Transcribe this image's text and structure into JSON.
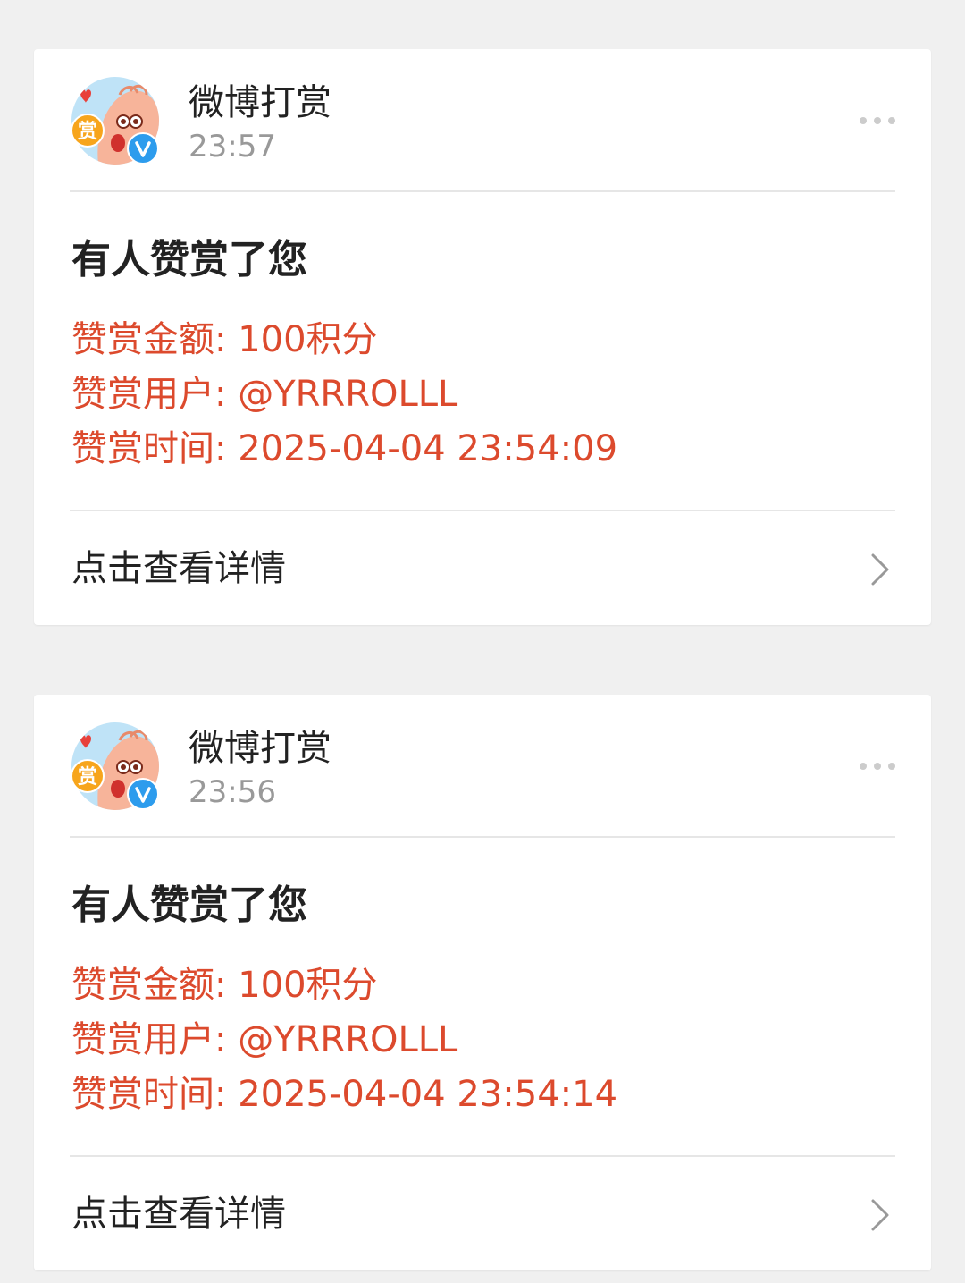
{
  "messages": [
    {
      "sender_name": "微博打赏",
      "avatar_text": "赏",
      "time": "23:57",
      "title": "有人赞赏了您",
      "amount_line": "赞赏金额: 100积分",
      "user_line": "赞赏用户: @YRRROLLL",
      "reward_time_line": "赞赏时间: 2025-04-04 23:54:09",
      "link_label": "点击查看详情"
    },
    {
      "sender_name": "微博打赏",
      "avatar_text": "赏",
      "time": "23:56",
      "title": "有人赞赏了您",
      "amount_line": "赞赏金额: 100积分",
      "user_line": "赞赏用户: @YRRROLLL",
      "reward_time_line": "赞赏时间: 2025-04-04 23:54:14",
      "link_label": "点击查看详情"
    }
  ],
  "colors": {
    "background": "#f0f0f0",
    "card": "#ffffff",
    "detail_text": "#dc4a2d",
    "verified_badge": "#2d9ced",
    "avatar_coin": "#f7a51c"
  },
  "icons": {
    "avatar": "weibo-reward-avatar",
    "verified": "verified-badge-icon",
    "more": "more-dots-icon",
    "chevron": "chevron-right-icon"
  }
}
